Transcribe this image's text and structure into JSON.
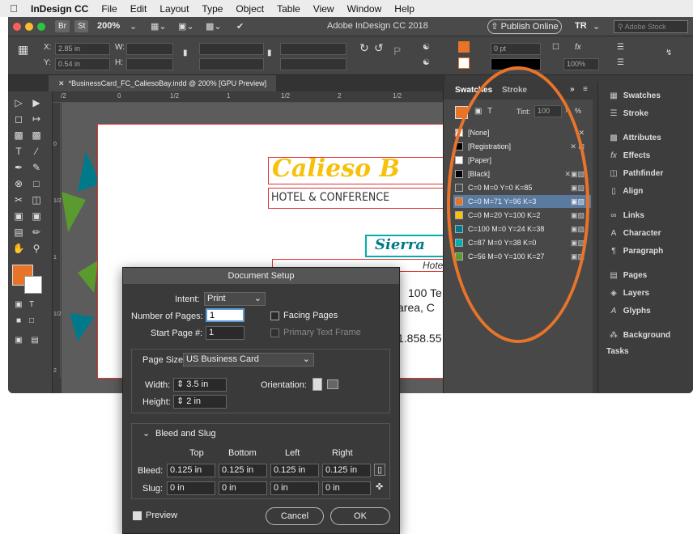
{
  "menubar": {
    "apple_icon": "apple-icon",
    "app_name": "InDesign CC",
    "items": [
      "File",
      "Edit",
      "Layout",
      "Type",
      "Object",
      "Table",
      "View",
      "Window",
      "Help"
    ]
  },
  "appbar": {
    "br_label": "Br",
    "st_label": "St",
    "zoom": "200%",
    "title": "Adobe InDesign CC 2018",
    "publish_label": "Publish Online",
    "tr_label": "TR",
    "search_placeholder": "Adobe Stock"
  },
  "controlbar": {
    "x_label": "X:",
    "x_value": "2.85 in",
    "y_label": "Y:",
    "y_value": "0.54 in",
    "w_label": "W:",
    "h_label": "H:",
    "stroke_weight": "0 pt",
    "opacity": "100%",
    "p_label": "P"
  },
  "document": {
    "tab_label": "*BusinessCard_FC_CaliesoBay.indd @ 200% [GPU Preview]",
    "ruler_ticks": [
      "/2",
      "0",
      "1/2",
      "1",
      "1/2",
      "2",
      "1/2"
    ],
    "vruler_ticks": [
      "0",
      "1/2",
      "1",
      "1/2",
      "2",
      "1/2",
      "2"
    ]
  },
  "card": {
    "brand": "Calieso B",
    "subtitle": "HOTEL & CONFERENCE",
    "script_text": "Sierra",
    "hotel_text": "Hotel",
    "address_line1": "100 Te",
    "address_line2": "area, C",
    "phone": "1.858.55"
  },
  "swatches_panel": {
    "tab_swatches": "Swatches",
    "tab_stroke": "Stroke",
    "tint_label": "Tint:",
    "tint_value": "100",
    "pct": "%",
    "t_label": "T",
    "items": [
      {
        "name": "[None]",
        "color": "#ffffff"
      },
      {
        "name": "[Registration]",
        "color": "#000000"
      },
      {
        "name": "[Paper]",
        "color": "#ffffff"
      },
      {
        "name": "[Black]",
        "color": "#000000"
      },
      {
        "name": "C=0 M=0 Y=0 K=85",
        "color": "#4a4a4a"
      },
      {
        "name": "C=0 M=71 Y=96 K=3",
        "color": "#e8742a"
      },
      {
        "name": "C=0 M=20 Y=100 K=2",
        "color": "#f7c10b"
      },
      {
        "name": "C=100 M=0 Y=24 K=38",
        "color": "#007a8a"
      },
      {
        "name": "C=87 M=0 Y=38 K=0",
        "color": "#00b0b0"
      },
      {
        "name": "C=56 M=0 Y=100 K=27",
        "color": "#5b9a2e"
      }
    ]
  },
  "right_panel": {
    "items": [
      "Swatches",
      "Stroke",
      "Attributes",
      "Effects",
      "Pathfinder",
      "Align",
      "Links",
      "Character",
      "Paragraph",
      "Pages",
      "Layers",
      "Glyphs",
      "Background Tasks"
    ]
  },
  "dialog": {
    "title": "Document Setup",
    "intent_label": "Intent:",
    "intent_value": "Print",
    "pages_label": "Number of Pages:",
    "pages_value": "1",
    "facing_label": "Facing Pages",
    "start_label": "Start Page #:",
    "start_value": "1",
    "primary_label": "Primary Text Frame",
    "pagesize_label": "Page Size:",
    "pagesize_value": "US Business Card",
    "width_label": "Width:",
    "width_value": "3.5 in",
    "height_label": "Height:",
    "height_value": "2 in",
    "orientation_label": "Orientation:",
    "bleed_slug_label": "Bleed and Slug",
    "col_top": "Top",
    "col_bottom": "Bottom",
    "col_left": "Left",
    "col_right": "Right",
    "bleed_label": "Bleed:",
    "bleed_values": [
      "0.125 in",
      "0.125 in",
      "0.125 in",
      "0.125 in"
    ],
    "slug_label": "Slug:",
    "slug_values": [
      "0 in",
      "0 in",
      "0 in",
      "0 in"
    ],
    "preview_label": "Preview",
    "cancel_label": "Cancel",
    "ok_label": "OK"
  },
  "colors": {
    "accent_orange": "#e8742a",
    "yellow": "#f7c10b",
    "teal": "#007a8a",
    "green": "#5b9a2e",
    "red_guide": "#d33333"
  }
}
